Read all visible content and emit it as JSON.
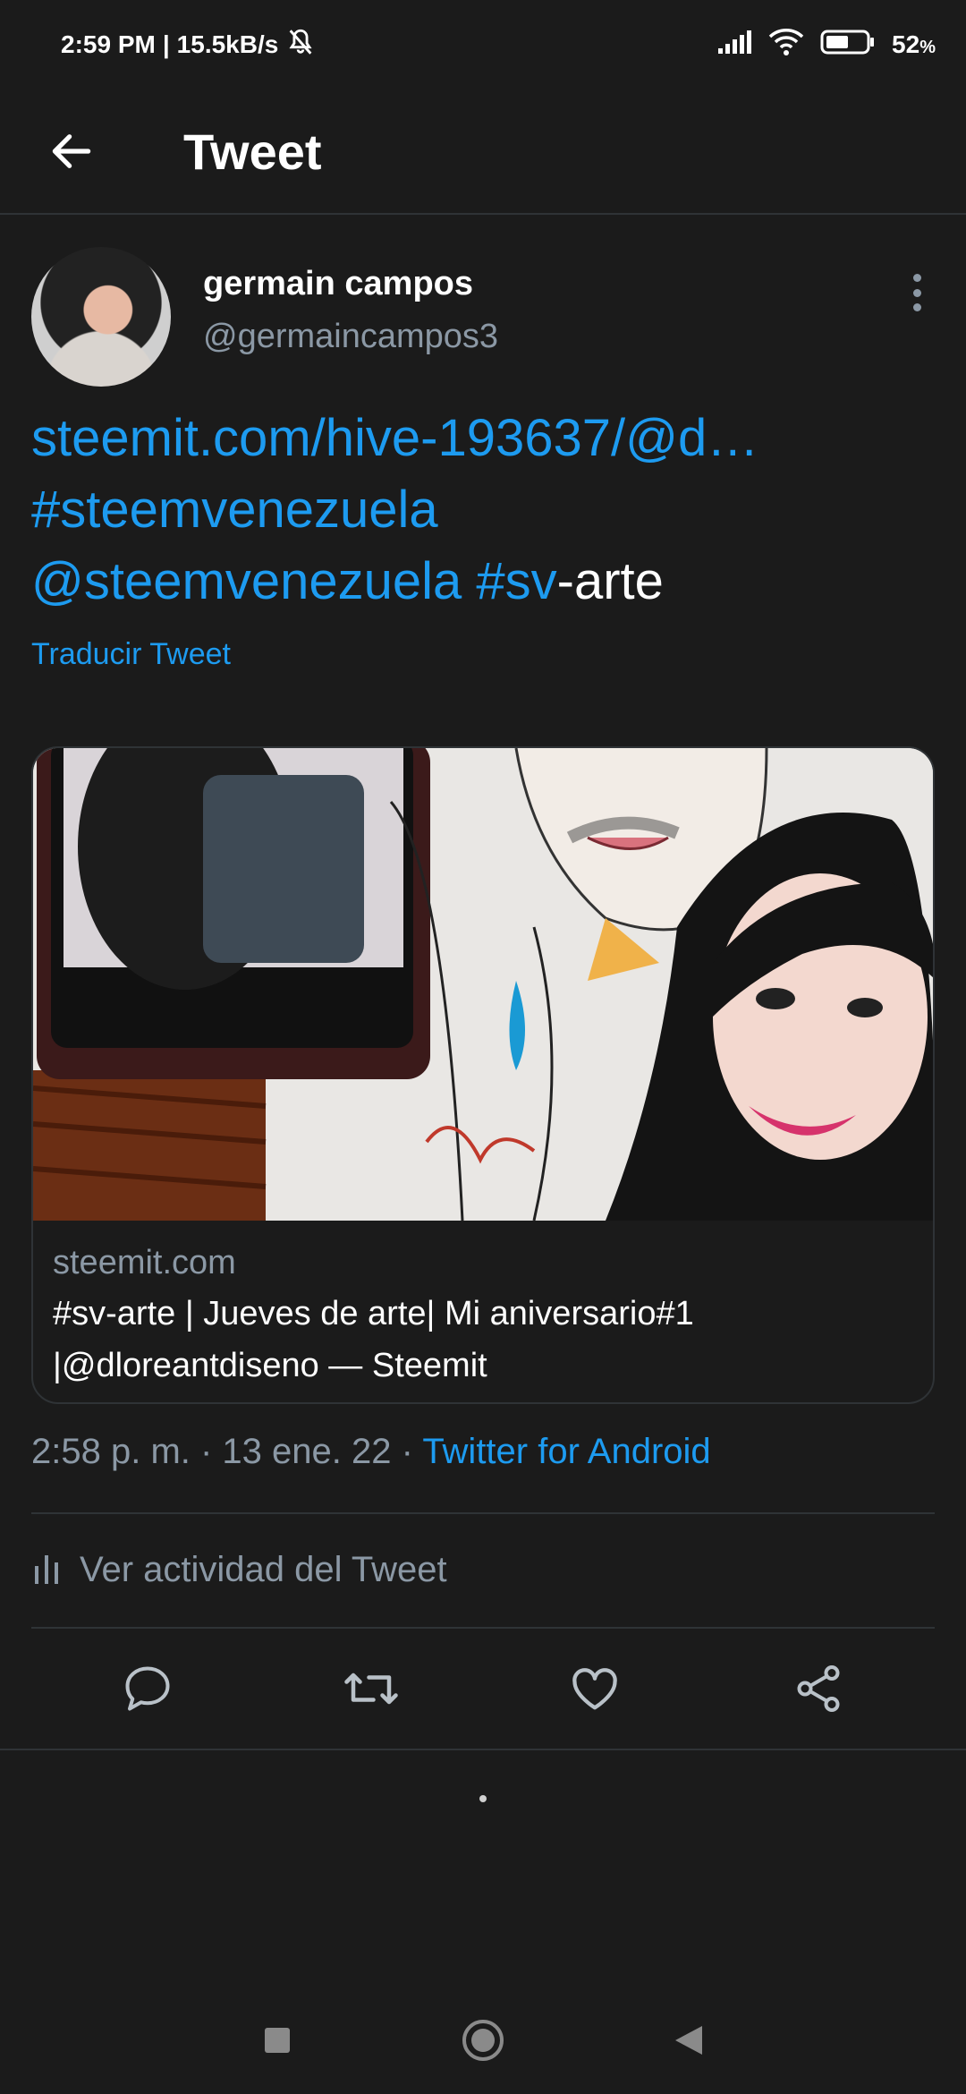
{
  "status_bar": {
    "time": "2:59 PM",
    "network_speed": "15.5kB/s",
    "separator": "|",
    "battery_percent": "52",
    "battery_unit": "%",
    "icons": [
      "mute-bell-icon",
      "signal-icon",
      "wifi-icon",
      "battery-icon"
    ]
  },
  "header": {
    "title": "Tweet",
    "back_icon": "arrow-left-icon"
  },
  "author": {
    "name": "germain campos",
    "handle": "@germaincampos3"
  },
  "tweet": {
    "line1_link": "steemit.com/hive-193637/@d…",
    "line2_hashtag": "#steemvenezuela",
    "line3_mention": "@steemvenezuela",
    "line3_space": " ",
    "line3_hashtag": "#sv",
    "line3_rest": "-arte",
    "translate_label": "Traducir Tweet"
  },
  "card": {
    "domain": "steemit.com",
    "title": "#sv-arte | Jueves de arte| Mi aniversario#1 |@dloreantdiseno — Steemit"
  },
  "meta": {
    "time": "2:58 p. m.",
    "dot1": " · ",
    "date": "13 ene. 22",
    "dot2": " · ",
    "source": "Twitter for Android"
  },
  "activity": {
    "label": "Ver actividad del Tweet",
    "icon": "bar-chart-icon"
  },
  "actions": [
    "reply-icon",
    "retweet-icon",
    "like-icon",
    "share-icon"
  ],
  "colors": {
    "background": "#1b1b1b",
    "link": "#1d9bf0",
    "secondary_text": "#8b98a5",
    "divider": "#2f3336"
  }
}
